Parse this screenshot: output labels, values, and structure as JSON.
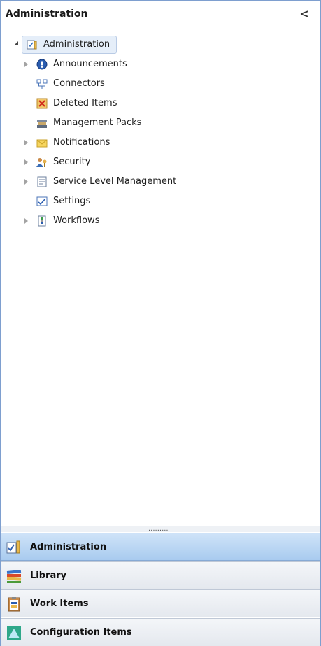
{
  "header": {
    "title": "Administration",
    "collapse_glyph": "<"
  },
  "tree": {
    "root": {
      "label": "Administration",
      "icon": "administration-icon",
      "expanded": true
    },
    "items": [
      {
        "label": "Announcements",
        "icon": "announcements-icon",
        "expandable": true
      },
      {
        "label": "Connectors",
        "icon": "connectors-icon",
        "expandable": false
      },
      {
        "label": "Deleted Items",
        "icon": "deleted-items-icon",
        "expandable": false
      },
      {
        "label": "Management Packs",
        "icon": "management-packs-icon",
        "expandable": false
      },
      {
        "label": "Notifications",
        "icon": "notifications-icon",
        "expandable": true
      },
      {
        "label": "Security",
        "icon": "security-icon",
        "expandable": true
      },
      {
        "label": "Service Level Management",
        "icon": "service-level-icon",
        "expandable": true
      },
      {
        "label": "Settings",
        "icon": "settings-icon",
        "expandable": false
      },
      {
        "label": "Workflows",
        "icon": "workflows-icon",
        "expandable": true
      }
    ]
  },
  "splitter": {
    "grip": "........."
  },
  "nav": [
    {
      "label": "Administration",
      "icon": "administration-nav-icon",
      "active": true
    },
    {
      "label": "Library",
      "icon": "library-icon",
      "active": false
    },
    {
      "label": "Work Items",
      "icon": "work-items-icon",
      "active": false
    },
    {
      "label": "Configuration Items",
      "icon": "configuration-items-icon",
      "active": false
    }
  ],
  "colors": {
    "accent": "#a9cbef",
    "border": "#7e9fcf",
    "selection": "#e5eef9"
  }
}
